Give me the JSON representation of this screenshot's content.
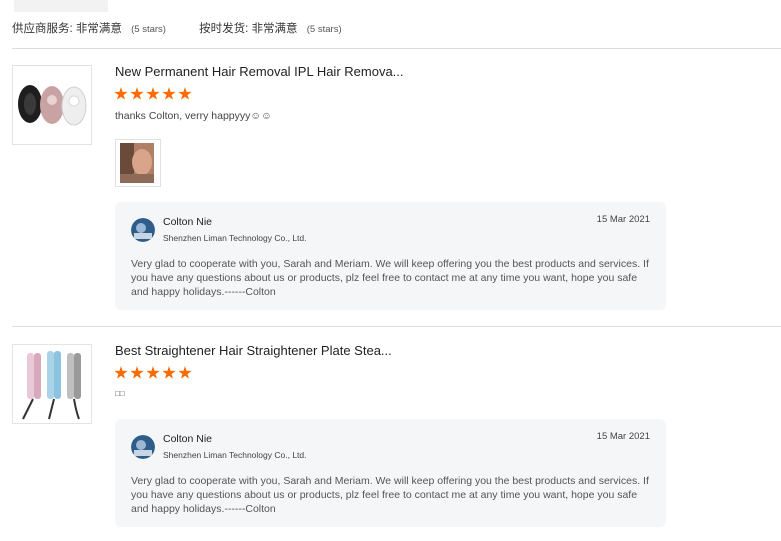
{
  "ratings": {
    "supplier_service": {
      "label": "供应商服务:",
      "value": "非常满意",
      "note": "(5 stars)"
    },
    "on_time_shipment": {
      "label": "按时发货:",
      "value": "非常满意",
      "note": "(5 stars)"
    }
  },
  "reviews": [
    {
      "product_title": "New Permanent Hair Removal IPL Hair Remova...",
      "rating": 5,
      "text": "thanks Colton, verry happyyy☺☺",
      "has_photo": true,
      "reply": {
        "seller_name": "Colton Nie",
        "company": "Shenzhen Liman Technology Co., Ltd.",
        "date": "15 Mar 2021",
        "text": "Very glad to cooperate with you, Sarah and Meriam. We will keep offering you the best products and services. If you have any questions about us or products, plz feel free to contact me at any time  you want, hope you safe and happy holidays.------Colton"
      }
    },
    {
      "product_title": "Best Straightener Hair Straightener Plate Stea...",
      "rating": 5,
      "text": "□□",
      "has_photo": false,
      "reply": {
        "seller_name": "Colton Nie",
        "company": "Shenzhen Liman Technology Co., Ltd.",
        "date": "15 Mar 2021",
        "text": "Very glad to cooperate with you, Sarah and Meriam. We will keep offering you the best products and services. If you have any questions about us or products, plz feel free to contact me at any time  you want, hope you safe and happy holidays.------Colton"
      }
    }
  ],
  "colors": {
    "star": "#ff6a00",
    "reply_bg": "#f5f6f8",
    "divider": "#dcdcdc"
  }
}
